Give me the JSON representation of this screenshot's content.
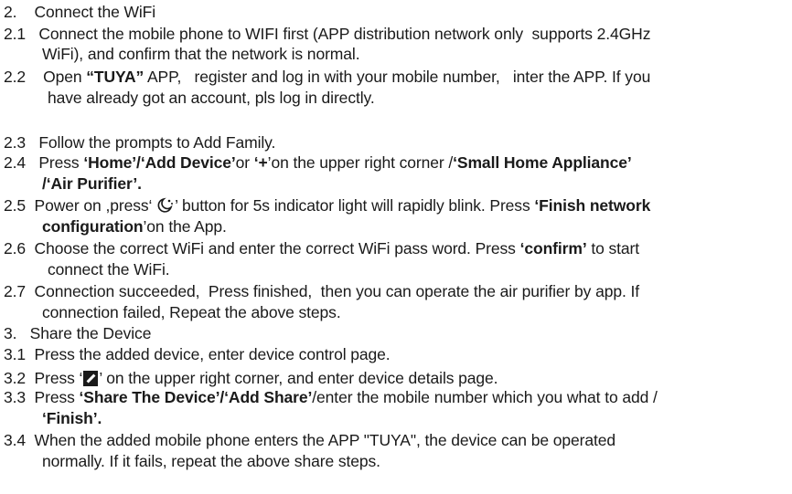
{
  "s2": {
    "heading": "2.    Connect the WiFi",
    "i21": {
      "l1": "2.1   Connect the mobile phone to WIFI first (APP distribution network only  supports 2.4GHz",
      "l2": "WiFi), and confirm that the network is normal."
    },
    "i22": {
      "a": "2.2    Open ",
      "b": "“TUYA”",
      "c": " APP,   register and log in with your mobile number,   inter the APP. If you",
      "l2": "have already got an account, pls log in directly."
    },
    "i23": "2.3   Follow the prompts to Add Family.",
    "i24": {
      "a": "2.4   Press ",
      "b": "‘Home’/‘Add Device’",
      "c": "or ",
      "d": "‘+",
      "e": "’on the upper right corner /",
      "f": "‘Small Home Appliance’",
      "l2": "/‘Air Purifier’."
    },
    "i25": {
      "a": "2.5  Power on ,press‘ ",
      "b": "’ button for 5s indicator light will rapidly blink. Press ",
      "c": "‘Finish network",
      "d": "configuration",
      "e": "’on the App."
    },
    "i26": {
      "a": "2.6  Choose the correct WiFi and enter the correct WiFi pass word. Press ",
      "b": "‘confirm’",
      "c": " to start",
      "l2": "connect the WiFi."
    },
    "i27": {
      "l1": "2.7  Connection succeeded,  Press finished,  then you can operate the air purifier by app. If",
      "l2": "connection failed, Repeat the above steps."
    }
  },
  "s3": {
    "heading": "3.   Share the Device",
    "i31": "3.1  Press the added device, enter device control page.",
    "i32": {
      "a": "3.2  Press ‘",
      "b": "’ on the upper right corner, and enter device details page."
    },
    "i33": {
      "a": "3.3  Press ",
      "b": "‘Share The Device’/‘Add Share’",
      "c": "/enter the mobile number which you what to add /",
      "d": "‘Finish’."
    },
    "i34": {
      "l1": "3.4  When the added mobile phone enters the APP \"TUYA\", the device can be operated",
      "l2": "normally. If it fails, repeat the above share steps."
    }
  },
  "icons": {
    "power_button": "moon-power-icon",
    "edit_button": "edit-icon"
  }
}
